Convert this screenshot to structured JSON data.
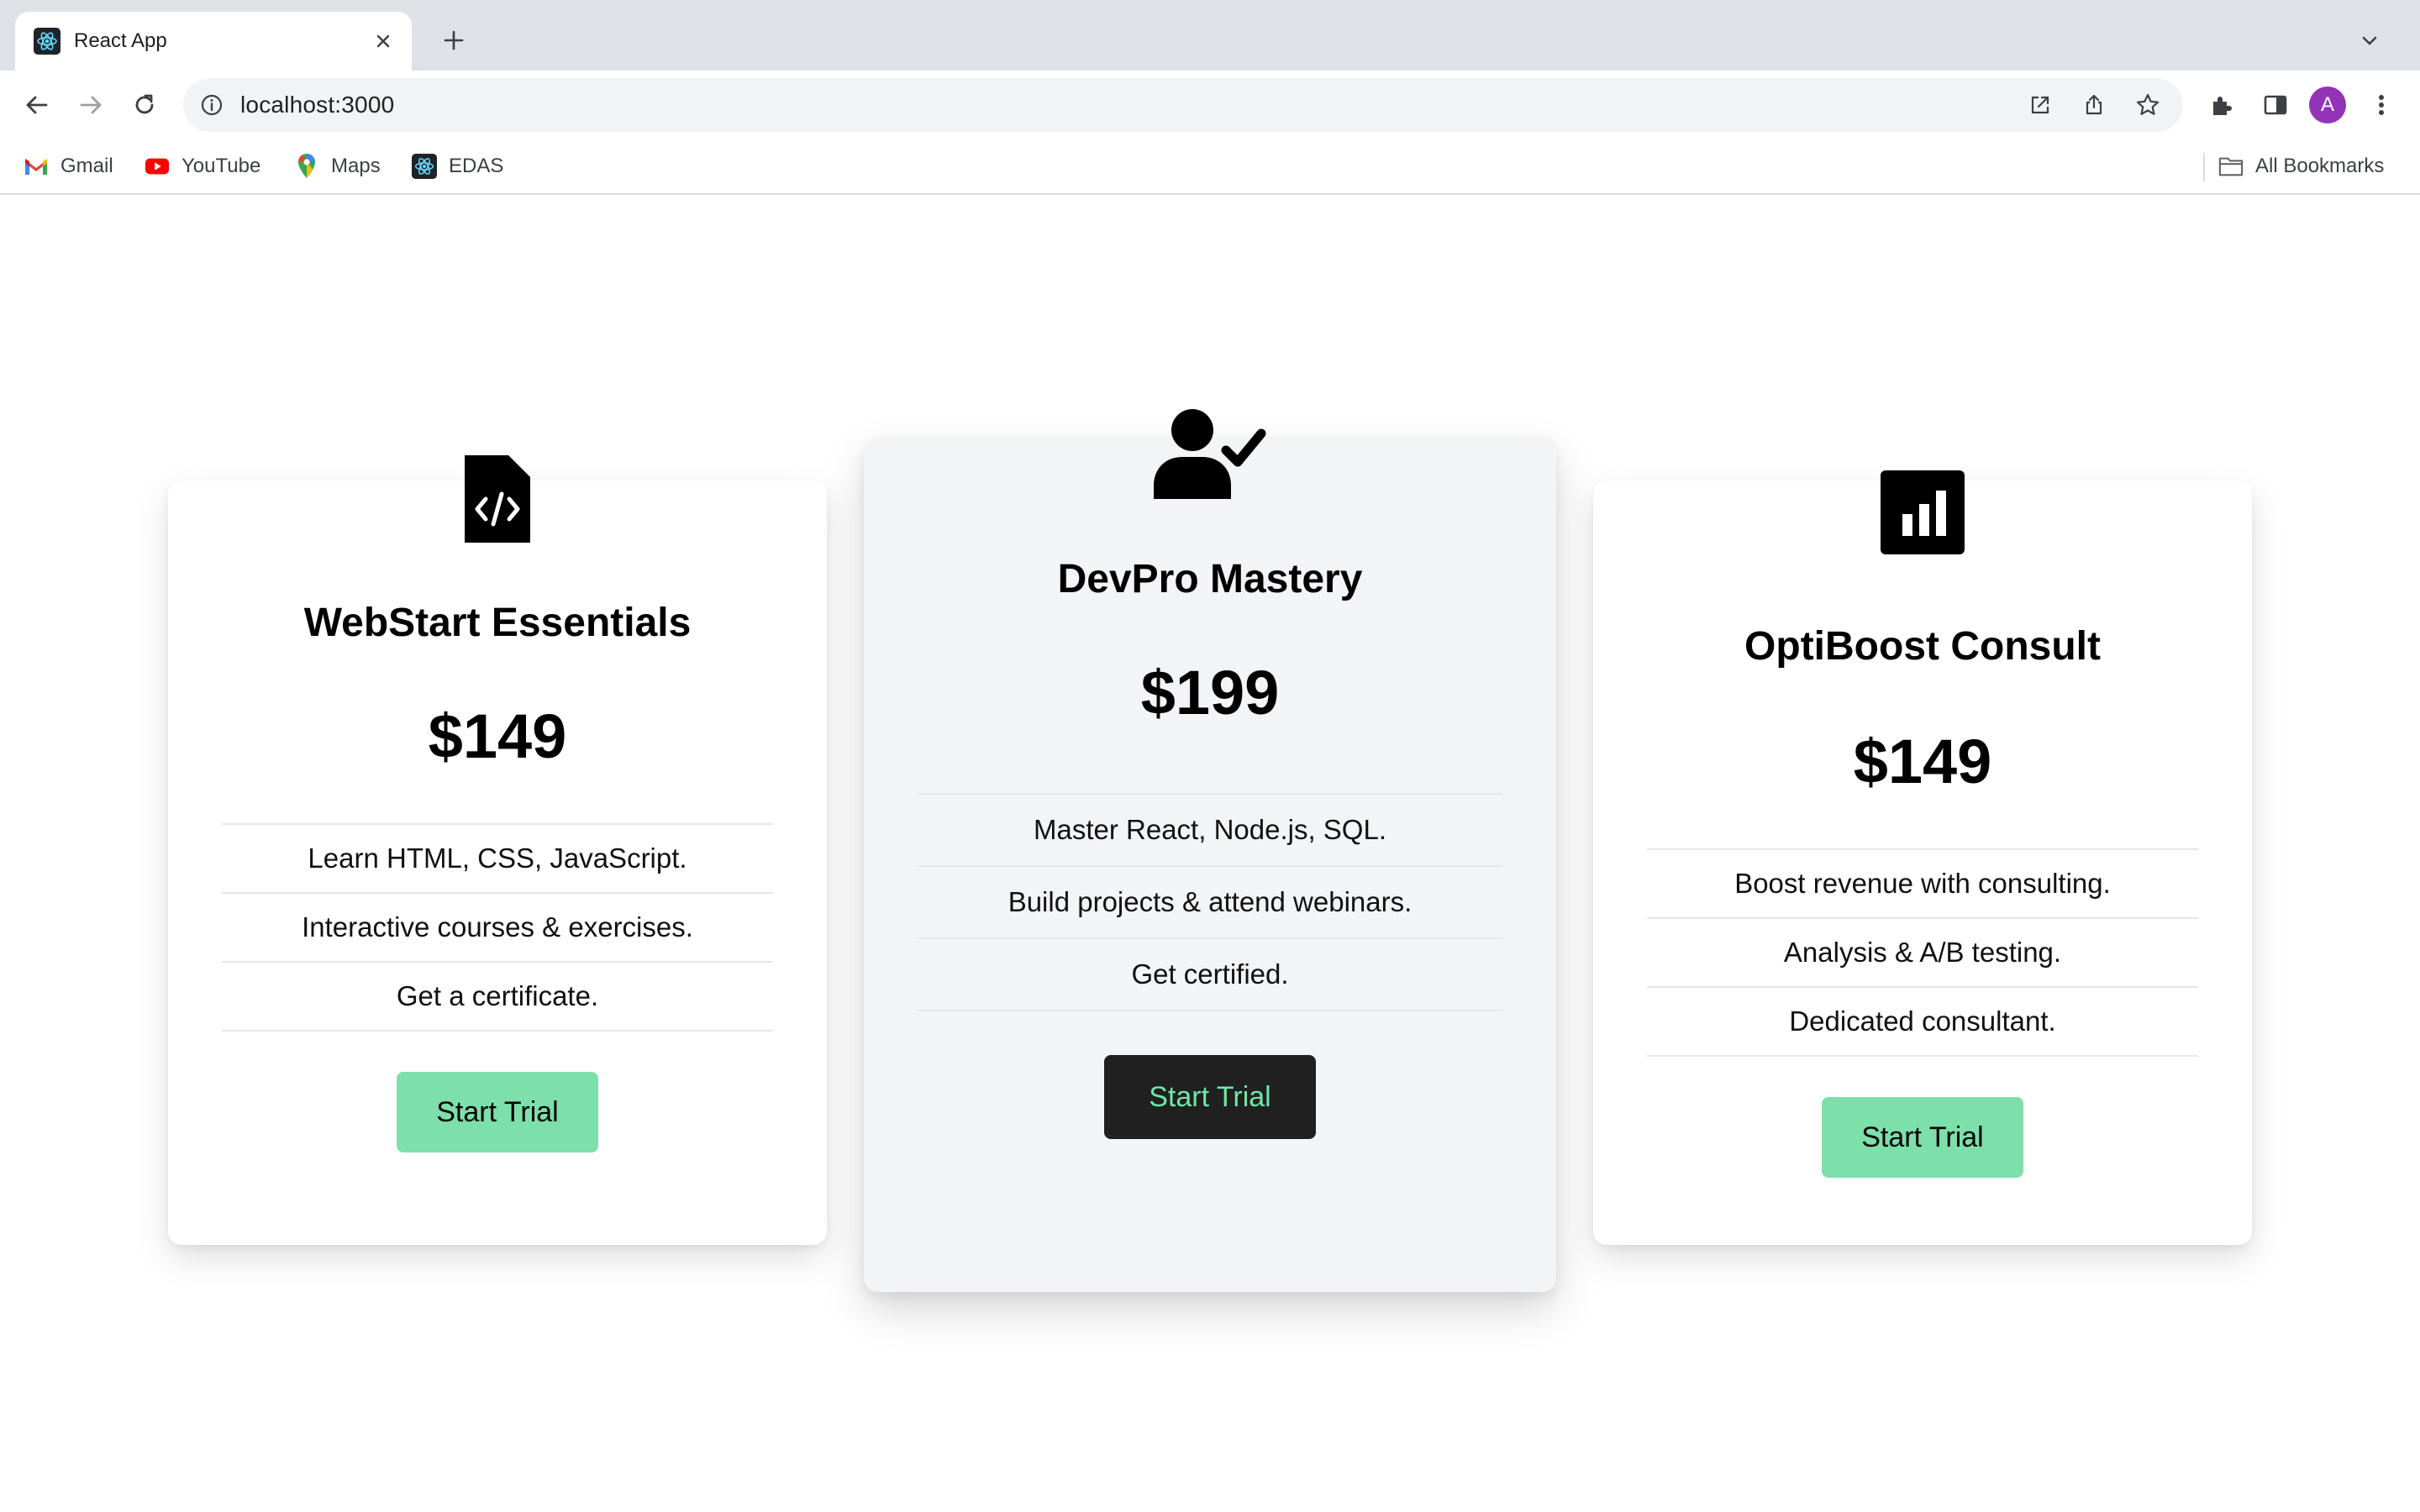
{
  "browser": {
    "tab": {
      "title": "React App",
      "favicon": "react-logo-icon"
    },
    "address_bar": {
      "url": "localhost:3000"
    },
    "profile_initial": "A",
    "colors": {
      "tabstrip": "#dee1e6",
      "avatar": "#9334b8"
    },
    "bookmarks": [
      {
        "label": "Gmail",
        "icon": "gmail-icon"
      },
      {
        "label": "YouTube",
        "icon": "youtube-icon"
      },
      {
        "label": "Maps",
        "icon": "maps-icon"
      },
      {
        "label": "EDAS",
        "icon": "react-logo-icon"
      }
    ],
    "all_bookmarks_label": "All Bookmarks"
  },
  "plans": [
    {
      "icon": "file-code-icon",
      "title": "WebStart Essentials",
      "price": "$149",
      "features": [
        "Learn HTML, CSS, JavaScript.",
        "Interactive courses & exercises.",
        "Get a certificate."
      ],
      "cta": "Start Trial"
    },
    {
      "icon": "user-check-icon",
      "title": "DevPro Mastery",
      "price": "$199",
      "features": [
        "Master React, Node.js, SQL.",
        "Build projects & attend webinars.",
        "Get certified."
      ],
      "cta": "Start Trial",
      "featured": true
    },
    {
      "icon": "chart-square-icon",
      "title": "OptiBoost Consult",
      "price": "$149",
      "features": [
        "Boost revenue with consulting.",
        "Analysis & A/B testing.",
        "Dedicated consultant."
      ],
      "cta": "Start Trial"
    }
  ],
  "colors": {
    "cta_light_bg": "#7ddfaa",
    "cta_dark_bg": "#202020",
    "cta_dark_text": "#6ee7a8",
    "featured_card_bg": "#f3f4f6"
  }
}
